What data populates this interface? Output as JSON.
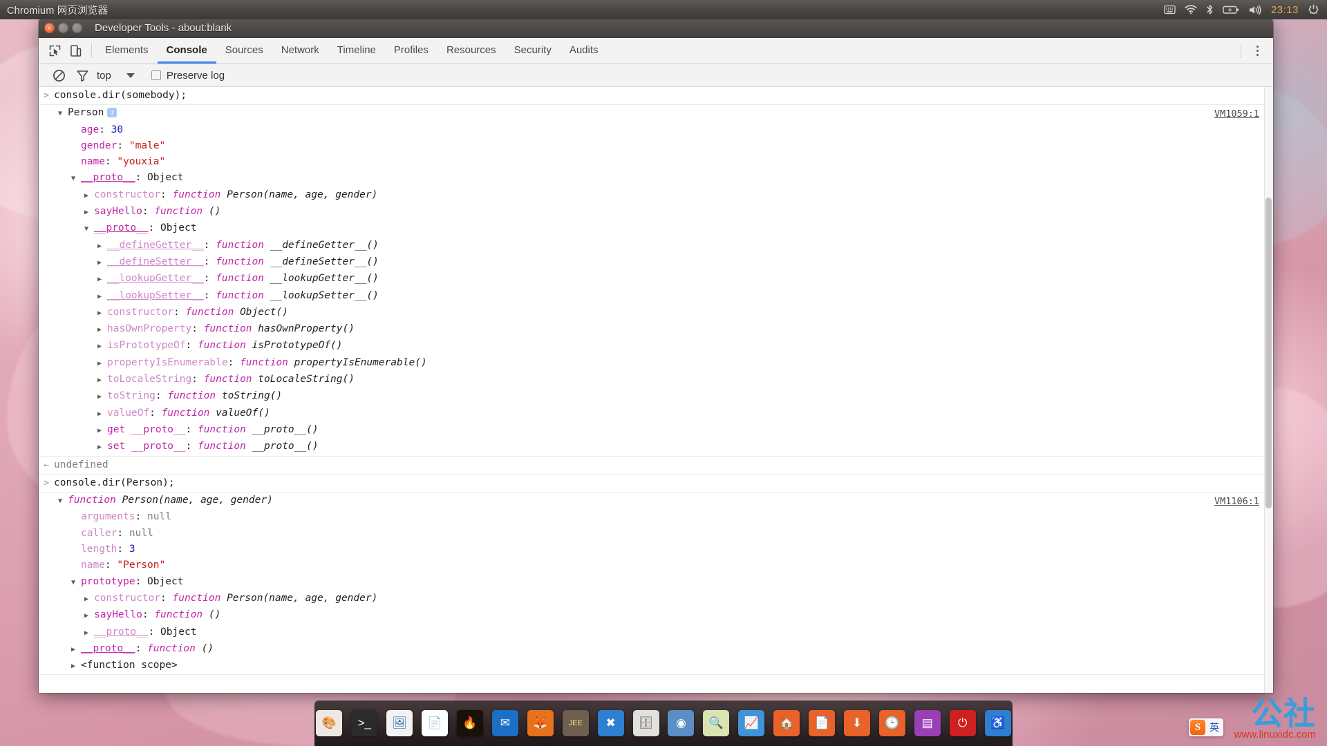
{
  "top_panel": {
    "app_title": "Chromium 网页浏览器",
    "tray": [
      {
        "name": "keyboard-indicator-icon",
        "glyph": "keyboard"
      },
      {
        "name": "wifi-icon",
        "glyph": "wifi"
      },
      {
        "name": "bluetooth-icon",
        "glyph": "bluetooth"
      },
      {
        "name": "battery-icon",
        "glyph": "battery"
      },
      {
        "name": "volume-icon",
        "glyph": "volume"
      }
    ],
    "clock": "23:13",
    "session_menu_icon": "power-gear-icon"
  },
  "window": {
    "title": "Developer Tools - about:blank",
    "close_label": "×",
    "minimize_label": "−",
    "maximize_label": "□"
  },
  "tabstrip": {
    "inspect_icon": "inspect-element-icon",
    "device_icon": "toggle-device-toolbar-icon",
    "tabs": [
      {
        "label": "Elements",
        "active": false
      },
      {
        "label": "Console",
        "active": true
      },
      {
        "label": "Sources",
        "active": false
      },
      {
        "label": "Network",
        "active": false
      },
      {
        "label": "Timeline",
        "active": false
      },
      {
        "label": "Profiles",
        "active": false
      },
      {
        "label": "Resources",
        "active": false
      },
      {
        "label": "Security",
        "active": false
      },
      {
        "label": "Audits",
        "active": false
      }
    ],
    "menu_icon": "more-options-kebab-icon",
    "active_tab_color": "#4285f4"
  },
  "console_toolbar": {
    "clear_icon": "clear-console-icon",
    "filter_icon": "filter-funnel-icon",
    "context": "top",
    "context_caret_icon": "chevron-down-icon",
    "preserve_log_label": "Preserve log",
    "preserve_log_checked": false
  },
  "console": {
    "entries": [
      {
        "type": "input",
        "marker": ">",
        "text": "console.dir(somebody);"
      },
      {
        "type": "output",
        "source_link": "VM1059:1",
        "lines": [
          {
            "indent": 0,
            "tri": "open",
            "tokens": [
              {
                "t": "Person",
                "c": "plain"
              }
            ],
            "badge": "i"
          },
          {
            "indent": 1,
            "tri": "none",
            "tokens": [
              {
                "t": "age",
                "c": "name"
              },
              {
                "t": ": ",
                "c": "plain"
              },
              {
                "t": "30",
                "c": "num"
              }
            ]
          },
          {
            "indent": 1,
            "tri": "none",
            "tokens": [
              {
                "t": "gender",
                "c": "name"
              },
              {
                "t": ": ",
                "c": "plain"
              },
              {
                "t": "\"male\"",
                "c": "str"
              }
            ]
          },
          {
            "indent": 1,
            "tri": "none",
            "tokens": [
              {
                "t": "name",
                "c": "name"
              },
              {
                "t": ": ",
                "c": "plain"
              },
              {
                "t": "\"youxia\"",
                "c": "str"
              }
            ]
          },
          {
            "indent": 1,
            "tri": "open",
            "tokens": [
              {
                "t": "__proto__",
                "c": "proto"
              },
              {
                "t": ": ",
                "c": "plain"
              },
              {
                "t": "Object",
                "c": "obj"
              }
            ]
          },
          {
            "indent": 2,
            "tri": "closed",
            "tokens": [
              {
                "t": "constructor",
                "c": "name-dim"
              },
              {
                "t": ": ",
                "c": "plain"
              },
              {
                "t": "function ",
                "c": "fnkw"
              },
              {
                "t": "Person(name, age, gender)",
                "c": "fnname"
              }
            ]
          },
          {
            "indent": 2,
            "tri": "closed",
            "tokens": [
              {
                "t": "sayHello",
                "c": "name"
              },
              {
                "t": ": ",
                "c": "plain"
              },
              {
                "t": "function ",
                "c": "fnkw"
              },
              {
                "t": "()",
                "c": "fnname"
              }
            ]
          },
          {
            "indent": 2,
            "tri": "open",
            "tokens": [
              {
                "t": "__proto__",
                "c": "proto"
              },
              {
                "t": ": ",
                "c": "plain"
              },
              {
                "t": "Object",
                "c": "obj"
              }
            ]
          },
          {
            "indent": 3,
            "tri": "closed",
            "tokens": [
              {
                "t": "__defineGetter__",
                "c": "proto-dim"
              },
              {
                "t": ": ",
                "c": "plain"
              },
              {
                "t": "function ",
                "c": "fnkw"
              },
              {
                "t": "__defineGetter__()",
                "c": "fnname"
              }
            ]
          },
          {
            "indent": 3,
            "tri": "closed",
            "tokens": [
              {
                "t": "__defineSetter__",
                "c": "proto-dim"
              },
              {
                "t": ": ",
                "c": "plain"
              },
              {
                "t": "function ",
                "c": "fnkw"
              },
              {
                "t": "__defineSetter__()",
                "c": "fnname"
              }
            ]
          },
          {
            "indent": 3,
            "tri": "closed",
            "tokens": [
              {
                "t": "__lookupGetter__",
                "c": "proto-dim"
              },
              {
                "t": ": ",
                "c": "plain"
              },
              {
                "t": "function ",
                "c": "fnkw"
              },
              {
                "t": "__lookupGetter__()",
                "c": "fnname"
              }
            ]
          },
          {
            "indent": 3,
            "tri": "closed",
            "tokens": [
              {
                "t": "__lookupSetter__",
                "c": "proto-dim"
              },
              {
                "t": ": ",
                "c": "plain"
              },
              {
                "t": "function ",
                "c": "fnkw"
              },
              {
                "t": "__lookupSetter__()",
                "c": "fnname"
              }
            ]
          },
          {
            "indent": 3,
            "tri": "closed",
            "tokens": [
              {
                "t": "constructor",
                "c": "name-dim"
              },
              {
                "t": ": ",
                "c": "plain"
              },
              {
                "t": "function ",
                "c": "fnkw"
              },
              {
                "t": "Object()",
                "c": "fnname"
              }
            ]
          },
          {
            "indent": 3,
            "tri": "closed",
            "tokens": [
              {
                "t": "hasOwnProperty",
                "c": "name-dim"
              },
              {
                "t": ": ",
                "c": "plain"
              },
              {
                "t": "function ",
                "c": "fnkw"
              },
              {
                "t": "hasOwnProperty()",
                "c": "fnname"
              }
            ]
          },
          {
            "indent": 3,
            "tri": "closed",
            "tokens": [
              {
                "t": "isPrototypeOf",
                "c": "name-dim"
              },
              {
                "t": ": ",
                "c": "plain"
              },
              {
                "t": "function ",
                "c": "fnkw"
              },
              {
                "t": "isPrototypeOf()",
                "c": "fnname"
              }
            ]
          },
          {
            "indent": 3,
            "tri": "closed",
            "tokens": [
              {
                "t": "propertyIsEnumerable",
                "c": "name-dim"
              },
              {
                "t": ": ",
                "c": "plain"
              },
              {
                "t": "function ",
                "c": "fnkw"
              },
              {
                "t": "propertyIsEnumerable()",
                "c": "fnname"
              }
            ]
          },
          {
            "indent": 3,
            "tri": "closed",
            "tokens": [
              {
                "t": "toLocaleString",
                "c": "name-dim"
              },
              {
                "t": ": ",
                "c": "plain"
              },
              {
                "t": "function ",
                "c": "fnkw"
              },
              {
                "t": "toLocaleString()",
                "c": "fnname"
              }
            ]
          },
          {
            "indent": 3,
            "tri": "closed",
            "tokens": [
              {
                "t": "toString",
                "c": "name-dim"
              },
              {
                "t": ": ",
                "c": "plain"
              },
              {
                "t": "function ",
                "c": "fnkw"
              },
              {
                "t": "toString()",
                "c": "fnname"
              }
            ]
          },
          {
            "indent": 3,
            "tri": "closed",
            "tokens": [
              {
                "t": "valueOf",
                "c": "name-dim"
              },
              {
                "t": ": ",
                "c": "plain"
              },
              {
                "t": "function ",
                "c": "fnkw"
              },
              {
                "t": "valueOf()",
                "c": "fnname"
              }
            ]
          },
          {
            "indent": 3,
            "tri": "closed",
            "tokens": [
              {
                "t": "get __proto__",
                "c": "name"
              },
              {
                "t": ": ",
                "c": "plain"
              },
              {
                "t": "function ",
                "c": "fnkw"
              },
              {
                "t": "__proto__()",
                "c": "fnname"
              }
            ]
          },
          {
            "indent": 3,
            "tri": "closed",
            "tokens": [
              {
                "t": "set __proto__",
                "c": "name"
              },
              {
                "t": ": ",
                "c": "plain"
              },
              {
                "t": "function ",
                "c": "fnkw"
              },
              {
                "t": "__proto__()",
                "c": "fnname"
              }
            ]
          }
        ]
      },
      {
        "type": "result",
        "marker": "←",
        "text": "undefined"
      },
      {
        "type": "input",
        "marker": ">",
        "text": "console.dir(Person);"
      },
      {
        "type": "output",
        "source_link": "VM1106:1",
        "lines": [
          {
            "indent": 0,
            "tri": "open",
            "tokens": [
              {
                "t": "function ",
                "c": "fnkw"
              },
              {
                "t": "Person(name, age, gender)",
                "c": "fnname"
              }
            ]
          },
          {
            "indent": 1,
            "tri": "none",
            "tokens": [
              {
                "t": "arguments",
                "c": "name-dim"
              },
              {
                "t": ": ",
                "c": "plain"
              },
              {
                "t": "null",
                "c": "null"
              }
            ]
          },
          {
            "indent": 1,
            "tri": "none",
            "tokens": [
              {
                "t": "caller",
                "c": "name-dim"
              },
              {
                "t": ": ",
                "c": "plain"
              },
              {
                "t": "null",
                "c": "null"
              }
            ]
          },
          {
            "indent": 1,
            "tri": "none",
            "tokens": [
              {
                "t": "length",
                "c": "name-dim"
              },
              {
                "t": ": ",
                "c": "plain"
              },
              {
                "t": "3",
                "c": "num"
              }
            ]
          },
          {
            "indent": 1,
            "tri": "none",
            "tokens": [
              {
                "t": "name",
                "c": "name-dim"
              },
              {
                "t": ": ",
                "c": "plain"
              },
              {
                "t": "\"Person\"",
                "c": "str"
              }
            ]
          },
          {
            "indent": 1,
            "tri": "open",
            "tokens": [
              {
                "t": "prototype",
                "c": "name"
              },
              {
                "t": ": ",
                "c": "plain"
              },
              {
                "t": "Object",
                "c": "obj"
              }
            ]
          },
          {
            "indent": 2,
            "tri": "closed",
            "tokens": [
              {
                "t": "constructor",
                "c": "name-dim"
              },
              {
                "t": ": ",
                "c": "plain"
              },
              {
                "t": "function ",
                "c": "fnkw"
              },
              {
                "t": "Person(name, age, gender)",
                "c": "fnname"
              }
            ]
          },
          {
            "indent": 2,
            "tri": "closed",
            "tokens": [
              {
                "t": "sayHello",
                "c": "name"
              },
              {
                "t": ": ",
                "c": "plain"
              },
              {
                "t": "function ",
                "c": "fnkw"
              },
              {
                "t": "()",
                "c": "fnname"
              }
            ]
          },
          {
            "indent": 2,
            "tri": "closed",
            "tokens": [
              {
                "t": "__proto__",
                "c": "proto-dim"
              },
              {
                "t": ": ",
                "c": "plain"
              },
              {
                "t": "Object",
                "c": "obj"
              }
            ]
          },
          {
            "indent": 1,
            "tri": "closed",
            "tokens": [
              {
                "t": "__proto__",
                "c": "proto"
              },
              {
                "t": ": ",
                "c": "plain"
              },
              {
                "t": "function ",
                "c": "fnkw"
              },
              {
                "t": "()",
                "c": "fnname"
              }
            ]
          },
          {
            "indent": 1,
            "tri": "closed",
            "tokens": [
              {
                "t": "<function scope>",
                "c": "plain"
              }
            ]
          }
        ]
      }
    ]
  },
  "dock": {
    "items": [
      {
        "name": "dock-item-gimp",
        "label": "GIMP",
        "glyph": "🎨",
        "bg": "#efe7e3",
        "fg": "#8a7f78"
      },
      {
        "name": "dock-item-terminal",
        "label": "Terminal",
        "glyph": ">_",
        "bg": "#2b2b2b",
        "fg": "#ffffff"
      },
      {
        "name": "dock-item-image-viewer",
        "label": "Image Viewer",
        "glyph": "🖼",
        "bg": "#f2f2f2",
        "fg": "#2a6aa8"
      },
      {
        "name": "dock-item-libreoffice-writer",
        "label": "LibreOffice Writer",
        "glyph": "📄",
        "bg": "#ffffff",
        "fg": "#1d74b8"
      },
      {
        "name": "dock-item-media-app",
        "label": "Media",
        "glyph": "🔥",
        "bg": "#171208",
        "fg": "#e9c24a"
      },
      {
        "name": "dock-item-thunderbird",
        "label": "Thunderbird",
        "glyph": "✉",
        "bg": "#1b6fc4",
        "fg": "#ffffff"
      },
      {
        "name": "dock-item-firefox",
        "label": "Firefox",
        "glyph": "🦊",
        "bg": "#e8721c",
        "fg": "#ffffff"
      },
      {
        "name": "dock-item-eclipse-javaee",
        "label": "Java EE IDE",
        "glyph": "JEE",
        "bg": "#6e5f50",
        "fg": "#f2d98a"
      },
      {
        "name": "dock-item-visual-studio",
        "label": "Visual Studio",
        "glyph": "✖",
        "bg": "#2f7fd0",
        "fg": "#ffffff"
      },
      {
        "name": "dock-item-file-cabinet",
        "label": "Archive Manager",
        "glyph": "🗄",
        "bg": "#e2e0dd",
        "fg": "#6c6a67"
      },
      {
        "name": "dock-item-chromium",
        "label": "Chromium",
        "glyph": "◉",
        "bg": "#5a8ec4",
        "fg": "#ffffff"
      },
      {
        "name": "dock-item-file-search",
        "label": "Search Files",
        "glyph": "🔍",
        "bg": "#d9e4b0",
        "fg": "#4a6020"
      },
      {
        "name": "dock-item-system-monitor",
        "label": "System Monitor",
        "glyph": "📈",
        "bg": "#3f93d8",
        "fg": "#ffffff"
      },
      {
        "name": "dock-item-home-folder",
        "label": "Home",
        "glyph": "🏠",
        "bg": "#e8622a",
        "fg": "#ffffff"
      },
      {
        "name": "dock-item-documents-folder",
        "label": "Documents",
        "glyph": "📄",
        "bg": "#e8622a",
        "fg": "#ffffff"
      },
      {
        "name": "dock-item-downloads-folder",
        "label": "Downloads",
        "glyph": "⬇",
        "bg": "#e8622a",
        "fg": "#ffffff"
      },
      {
        "name": "dock-item-recent-folder",
        "label": "Recent",
        "glyph": "🕒",
        "bg": "#e8622a",
        "fg": "#ffffff"
      },
      {
        "name": "dock-item-workspace-switcher",
        "label": "Workspaces",
        "glyph": "▤",
        "bg": "#9b3fb5",
        "fg": "#ffffff"
      },
      {
        "name": "dock-item-power",
        "label": "Shutdown",
        "glyph": "⏻",
        "bg": "#cf2020",
        "fg": "#ffffff"
      },
      {
        "name": "dock-item-accessibility",
        "label": "Accessibility",
        "glyph": "♿",
        "bg": "#2f7fd0",
        "fg": "#ffffff"
      }
    ]
  },
  "watermark": {
    "logo_text": "公社",
    "brand": "Linux",
    "url": "www.linuxidc.com",
    "ime_logo": "S",
    "ime_text": "英"
  }
}
